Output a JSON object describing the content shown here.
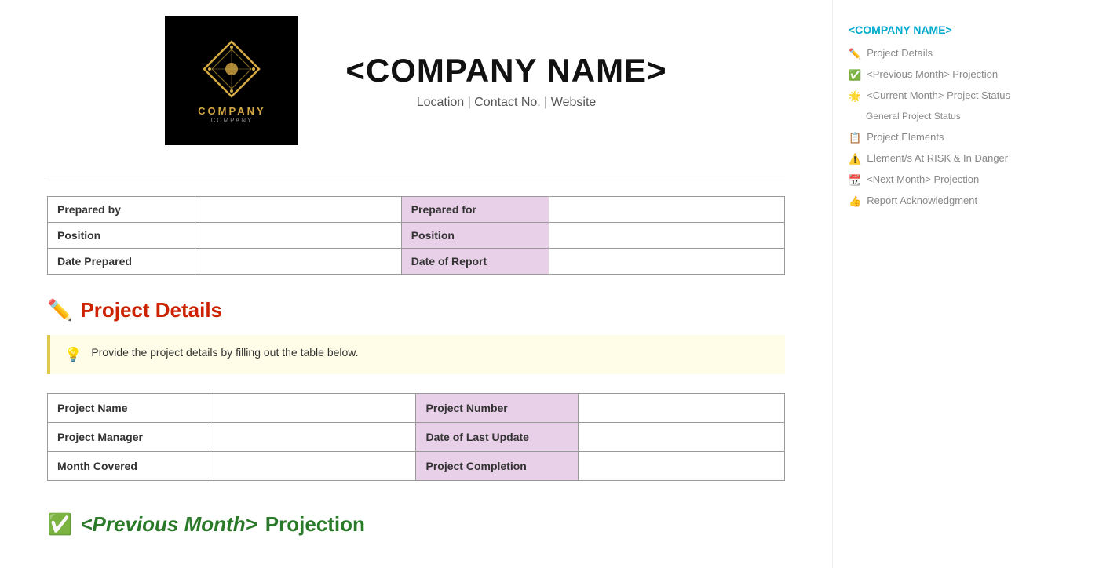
{
  "header": {
    "company_name": "<COMPANY NAME>",
    "subtitle": "Location | Contact No. | Website",
    "logo_company_text": "COMPANY",
    "logo_sub_text": "company"
  },
  "header_table": {
    "row1": {
      "label1": "Prepared by",
      "value1": "",
      "label2": "Prepared for",
      "value2": ""
    },
    "row2": {
      "label1": "Position",
      "value1": "",
      "label2": "Position",
      "value2": ""
    },
    "row3": {
      "label1": "Date Prepared",
      "value1": "",
      "label2": "Date of Report",
      "value2": ""
    }
  },
  "project_details": {
    "section_icon": "✏️",
    "section_title": "Project Details",
    "callout_icon": "💡",
    "callout_text": "Provide the project details by filling out the table below.",
    "table": {
      "row1": {
        "label1": "Project Name",
        "value1": "",
        "label2": "Project Number",
        "value2": ""
      },
      "row2": {
        "label1": "Project Manager",
        "value1": "",
        "label2": "Date of Last Update",
        "value2": ""
      },
      "row3": {
        "label1": "Month Covered",
        "value1": "",
        "label2": "Project Completion",
        "value2": ""
      }
    }
  },
  "previous_month": {
    "section_icon": "✅",
    "section_title_pre": "",
    "section_italic": "<Previous Month>",
    "section_post": " Projection"
  },
  "sidebar": {
    "company_link": "<COMPANY NAME>",
    "nav_items": [
      {
        "icon": "✏️",
        "label": "Project Details"
      },
      {
        "icon": "✅",
        "label": "<Previous Month> Projection"
      },
      {
        "icon": "🌟",
        "label": "<Current Month> Project Status"
      },
      {
        "icon": "sub",
        "label": "General Project Status"
      },
      {
        "icon": "📋",
        "label": "Project Elements"
      },
      {
        "icon": "⚠️",
        "label": "Element/s At RISK & In Danger"
      },
      {
        "icon": "📆",
        "label": "<Next Month> Projection"
      },
      {
        "icon": "👍",
        "label": "Report Acknowledgment"
      }
    ]
  }
}
